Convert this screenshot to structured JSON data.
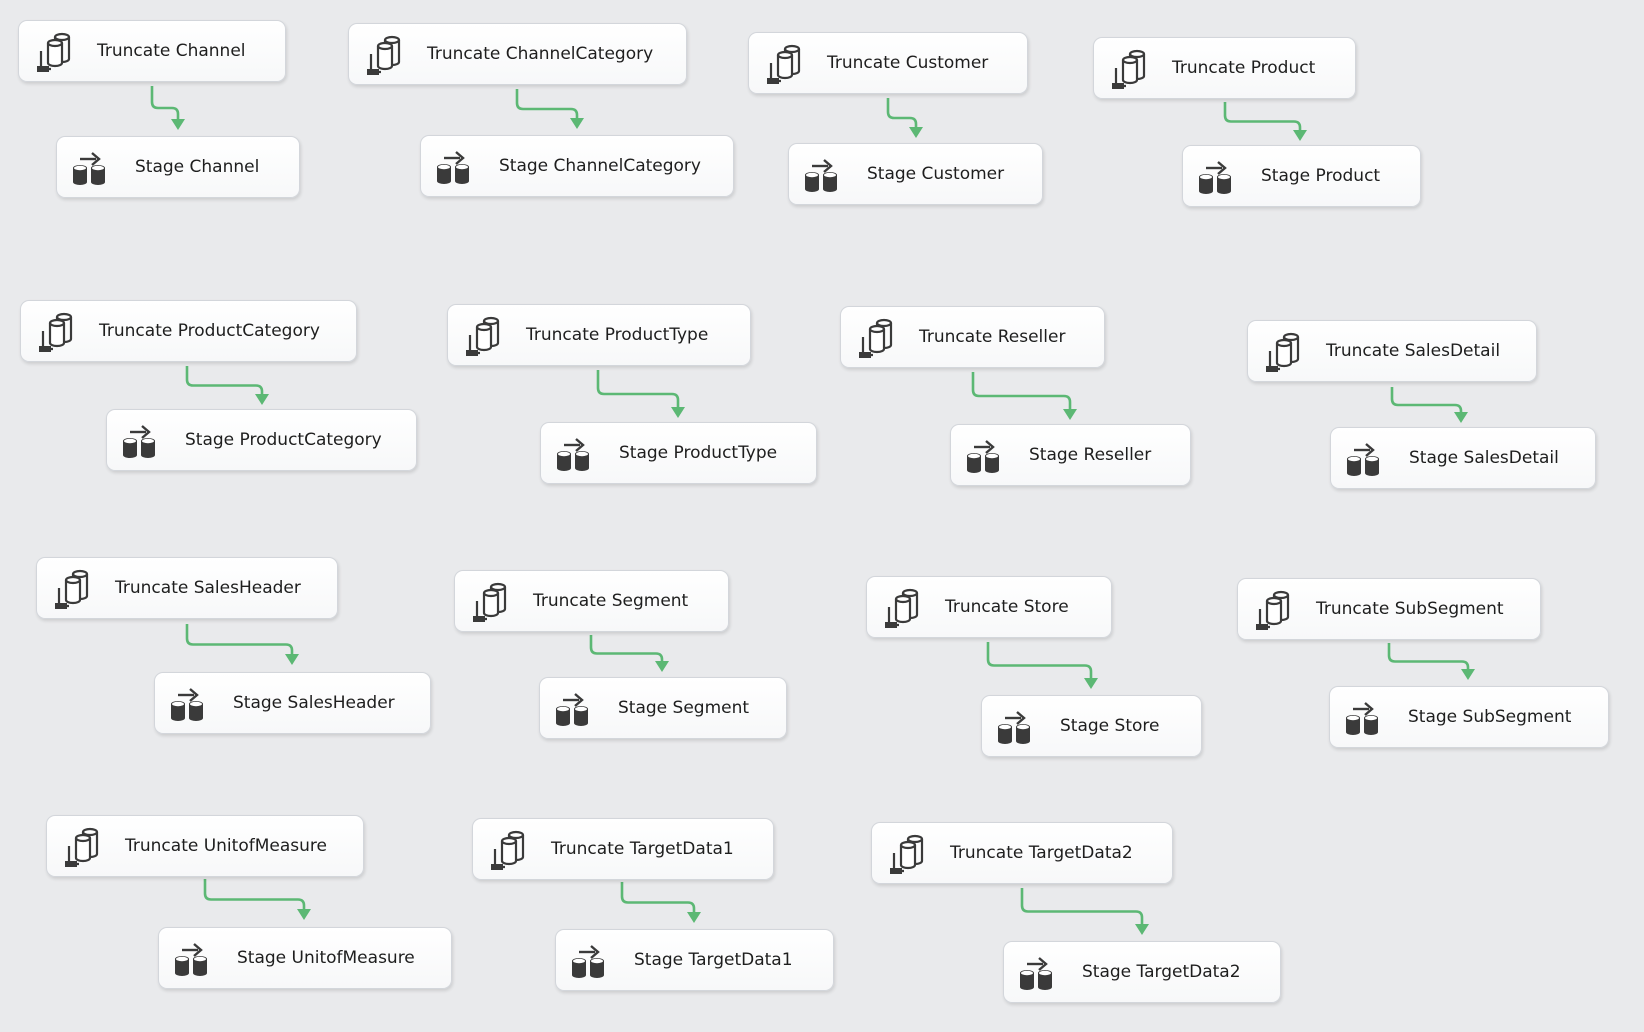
{
  "groups": [
    {
      "truncate": {
        "label": "Truncate Channel",
        "icon": "sql-task-icon"
      },
      "stage": {
        "label": "Stage Channel",
        "icon": "data-flow-task-icon"
      }
    },
    {
      "truncate": {
        "label": "Truncate ChannelCategory",
        "icon": "sql-task-icon"
      },
      "stage": {
        "label": "Stage ChannelCategory",
        "icon": "data-flow-task-icon"
      }
    },
    {
      "truncate": {
        "label": "Truncate Customer",
        "icon": "sql-task-icon"
      },
      "stage": {
        "label": "Stage Customer",
        "icon": "data-flow-task-icon"
      }
    },
    {
      "truncate": {
        "label": "Truncate Product",
        "icon": "sql-task-icon"
      },
      "stage": {
        "label": "Stage Product",
        "icon": "data-flow-task-icon"
      }
    },
    {
      "truncate": {
        "label": "Truncate ProductCategory",
        "icon": "sql-task-icon"
      },
      "stage": {
        "label": "Stage ProductCategory",
        "icon": "data-flow-task-icon"
      }
    },
    {
      "truncate": {
        "label": "Truncate ProductType",
        "icon": "sql-task-icon"
      },
      "stage": {
        "label": "Stage ProductType",
        "icon": "data-flow-task-icon"
      }
    },
    {
      "truncate": {
        "label": "Truncate Reseller",
        "icon": "sql-task-icon"
      },
      "stage": {
        "label": "Stage Reseller",
        "icon": "data-flow-task-icon"
      }
    },
    {
      "truncate": {
        "label": "Truncate SalesDetail",
        "icon": "sql-task-icon"
      },
      "stage": {
        "label": "Stage SalesDetail",
        "icon": "data-flow-task-icon"
      }
    },
    {
      "truncate": {
        "label": "Truncate SalesHeader",
        "icon": "sql-task-icon"
      },
      "stage": {
        "label": "Stage SalesHeader",
        "icon": "data-flow-task-icon"
      }
    },
    {
      "truncate": {
        "label": "Truncate Segment",
        "icon": "sql-task-icon"
      },
      "stage": {
        "label": "Stage Segment",
        "icon": "data-flow-task-icon"
      }
    },
    {
      "truncate": {
        "label": "Truncate Store",
        "icon": "sql-task-icon"
      },
      "stage": {
        "label": "Stage Store",
        "icon": "data-flow-task-icon"
      }
    },
    {
      "truncate": {
        "label": "Truncate SubSegment",
        "icon": "sql-task-icon"
      },
      "stage": {
        "label": "Stage SubSegment",
        "icon": "data-flow-task-icon"
      }
    },
    {
      "truncate": {
        "label": "Truncate UnitofMeasure",
        "icon": "sql-task-icon"
      },
      "stage": {
        "label": "Stage UnitofMeasure",
        "icon": "data-flow-task-icon"
      }
    },
    {
      "truncate": {
        "label": "Truncate TargetData1",
        "icon": "sql-task-icon"
      },
      "stage": {
        "label": "Stage TargetData1",
        "icon": "data-flow-task-icon"
      }
    },
    {
      "truncate": {
        "label": "Truncate TargetData2",
        "icon": "sql-task-icon"
      },
      "stage": {
        "label": "Stage TargetData2",
        "icon": "data-flow-task-icon"
      }
    }
  ],
  "colors": {
    "canvas": "#e9eaec",
    "connector": "#5cb874",
    "icon": "#3a3a3a"
  }
}
